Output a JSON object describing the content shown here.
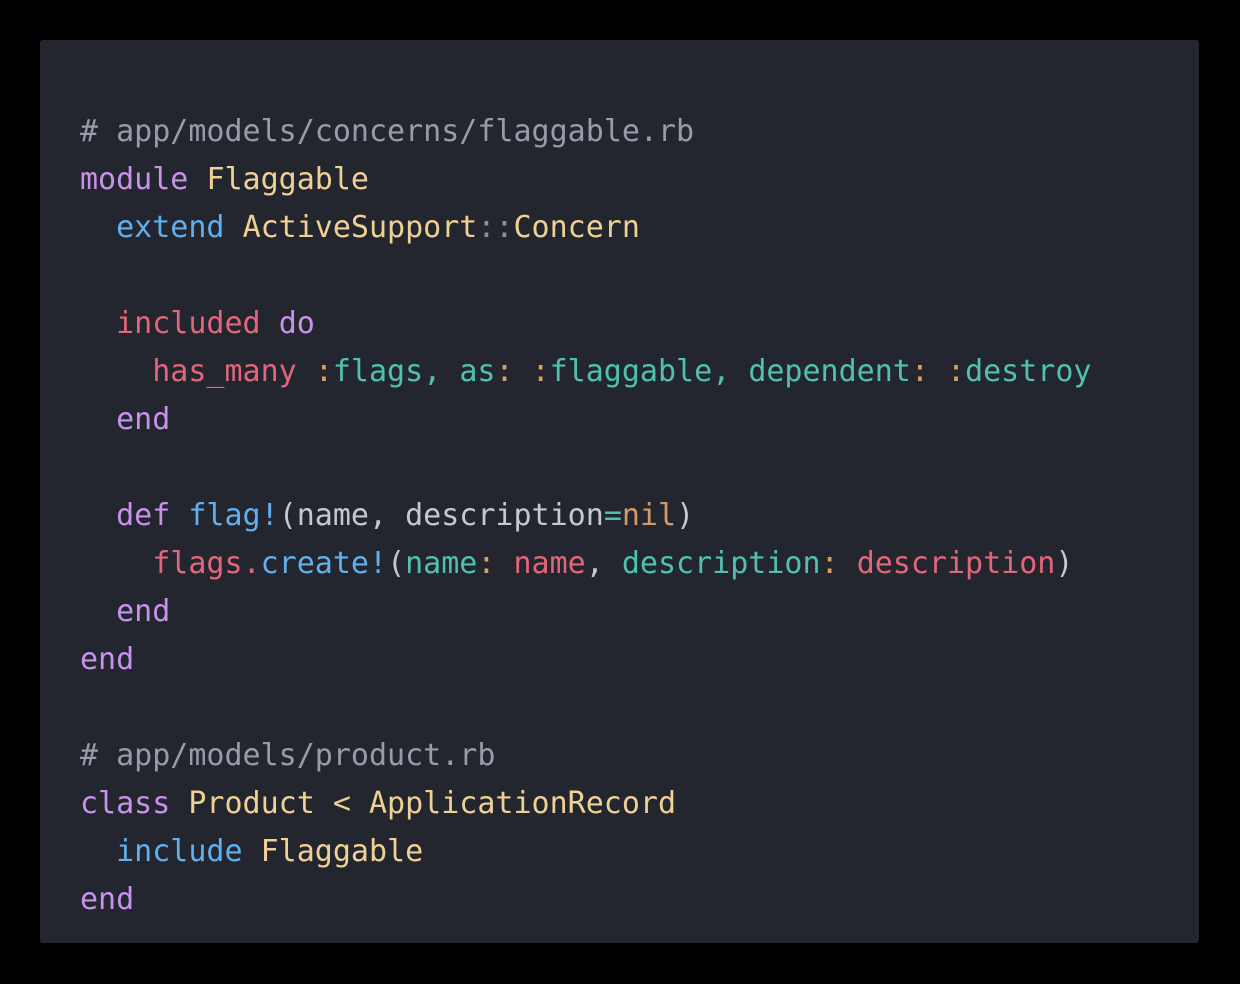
{
  "theme": {
    "page_background": "#000000",
    "card_background": "#24262F",
    "comment": "#969CA8",
    "keyword": "#C792EA",
    "constant": "#EFD196",
    "function": "#61AFEF",
    "method": "#E1667B",
    "symbol": "#4FC1B0",
    "symbol_colon": "#D9A066",
    "param": "#C3C8D2",
    "number": "#D19A66",
    "operator": "#4FC1B0",
    "separator": "#8A90A0"
  },
  "snippet": {
    "language": "ruby",
    "files": [
      "app/models/concerns/flaggable.rb",
      "app/models/product.rb"
    ],
    "plain_text": "# app/models/concerns/flaggable.rb\nmodule Flaggable\n  extend ActiveSupport::Concern\n\n  included do\n    has_many :flags, as: :flaggable, dependent: :destroy\n  end\n\n  def flag!(name, description=nil)\n    flags.create!(name: name, description: description)\n  end\nend\n\n# app/models/product.rb\nclass Product < ApplicationRecord\n  include Flaggable\nend",
    "lines": [
      {
        "index": 1,
        "tokens": [
          {
            "text": "# app/models/concerns/flaggable.rb",
            "kind": "comment"
          }
        ]
      },
      {
        "index": 2,
        "tokens": [
          {
            "text": "module",
            "kind": "keyword"
          },
          {
            "text": " ",
            "kind": "plain"
          },
          {
            "text": "Flaggable",
            "kind": "const"
          }
        ]
      },
      {
        "index": 3,
        "tokens": [
          {
            "text": "  ",
            "kind": "plain"
          },
          {
            "text": "extend",
            "kind": "func"
          },
          {
            "text": " ",
            "kind": "plain"
          },
          {
            "text": "ActiveSupport",
            "kind": "const"
          },
          {
            "text": "::",
            "kind": "sep"
          },
          {
            "text": "Concern",
            "kind": "const"
          }
        ]
      },
      {
        "index": 4,
        "tokens": []
      },
      {
        "index": 5,
        "tokens": [
          {
            "text": "  ",
            "kind": "plain"
          },
          {
            "text": "included",
            "kind": "method"
          },
          {
            "text": " ",
            "kind": "plain"
          },
          {
            "text": "do",
            "kind": "keyword"
          }
        ]
      },
      {
        "index": 6,
        "tokens": [
          {
            "text": "    ",
            "kind": "plain"
          },
          {
            "text": "has_many",
            "kind": "method"
          },
          {
            "text": " ",
            "kind": "plain"
          },
          {
            "text": ":",
            "kind": "punct-sym"
          },
          {
            "text": "flags",
            "kind": "symbol"
          },
          {
            "text": ",",
            "kind": "symbol"
          },
          {
            "text": " ",
            "kind": "plain"
          },
          {
            "text": "as",
            "kind": "symbol"
          },
          {
            "text": ":",
            "kind": "punct-sym"
          },
          {
            "text": " ",
            "kind": "plain"
          },
          {
            "text": ":",
            "kind": "punct-sym"
          },
          {
            "text": "flaggable",
            "kind": "symbol"
          },
          {
            "text": ",",
            "kind": "symbol"
          },
          {
            "text": " ",
            "kind": "plain"
          },
          {
            "text": "dependent",
            "kind": "symbol"
          },
          {
            "text": ":",
            "kind": "punct-sym"
          },
          {
            "text": " ",
            "kind": "plain"
          },
          {
            "text": ":",
            "kind": "punct-sym"
          },
          {
            "text": "destroy",
            "kind": "symbol"
          }
        ]
      },
      {
        "index": 7,
        "tokens": [
          {
            "text": "  ",
            "kind": "plain"
          },
          {
            "text": "end",
            "kind": "keyword"
          }
        ]
      },
      {
        "index": 8,
        "tokens": []
      },
      {
        "index": 9,
        "tokens": [
          {
            "text": "  ",
            "kind": "plain"
          },
          {
            "text": "def",
            "kind": "keyword"
          },
          {
            "text": " ",
            "kind": "plain"
          },
          {
            "text": "flag!",
            "kind": "func"
          },
          {
            "text": "(",
            "kind": "param"
          },
          {
            "text": "name",
            "kind": "param"
          },
          {
            "text": ", ",
            "kind": "param"
          },
          {
            "text": "description",
            "kind": "param"
          },
          {
            "text": "=",
            "kind": "operator"
          },
          {
            "text": "nil",
            "kind": "number"
          },
          {
            "text": ")",
            "kind": "param"
          }
        ]
      },
      {
        "index": 10,
        "tokens": [
          {
            "text": "    ",
            "kind": "plain"
          },
          {
            "text": "flags",
            "kind": "method"
          },
          {
            "text": ".",
            "kind": "method"
          },
          {
            "text": "create!",
            "kind": "func"
          },
          {
            "text": "(",
            "kind": "param"
          },
          {
            "text": "name",
            "kind": "symbol"
          },
          {
            "text": ":",
            "kind": "punct-sym"
          },
          {
            "text": " ",
            "kind": "plain"
          },
          {
            "text": "name",
            "kind": "method"
          },
          {
            "text": ",",
            "kind": "param"
          },
          {
            "text": " ",
            "kind": "plain"
          },
          {
            "text": "description",
            "kind": "symbol"
          },
          {
            "text": ":",
            "kind": "punct-sym"
          },
          {
            "text": " ",
            "kind": "plain"
          },
          {
            "text": "description",
            "kind": "method"
          },
          {
            "text": ")",
            "kind": "param"
          }
        ]
      },
      {
        "index": 11,
        "tokens": [
          {
            "text": "  ",
            "kind": "plain"
          },
          {
            "text": "end",
            "kind": "keyword"
          }
        ]
      },
      {
        "index": 12,
        "tokens": [
          {
            "text": "end",
            "kind": "keyword"
          }
        ]
      },
      {
        "index": 13,
        "tokens": []
      },
      {
        "index": 14,
        "tokens": [
          {
            "text": "# app/models/product.rb",
            "kind": "comment"
          }
        ]
      },
      {
        "index": 15,
        "tokens": [
          {
            "text": "class",
            "kind": "keyword"
          },
          {
            "text": " ",
            "kind": "plain"
          },
          {
            "text": "Product",
            "kind": "const"
          },
          {
            "text": " ",
            "kind": "plain"
          },
          {
            "text": "<",
            "kind": "const"
          },
          {
            "text": " ",
            "kind": "plain"
          },
          {
            "text": "ApplicationRecord",
            "kind": "const"
          }
        ]
      },
      {
        "index": 16,
        "tokens": [
          {
            "text": "  ",
            "kind": "plain"
          },
          {
            "text": "include",
            "kind": "func"
          },
          {
            "text": " ",
            "kind": "plain"
          },
          {
            "text": "Flaggable",
            "kind": "const"
          }
        ]
      },
      {
        "index": 17,
        "tokens": [
          {
            "text": "end",
            "kind": "keyword"
          }
        ]
      }
    ]
  }
}
